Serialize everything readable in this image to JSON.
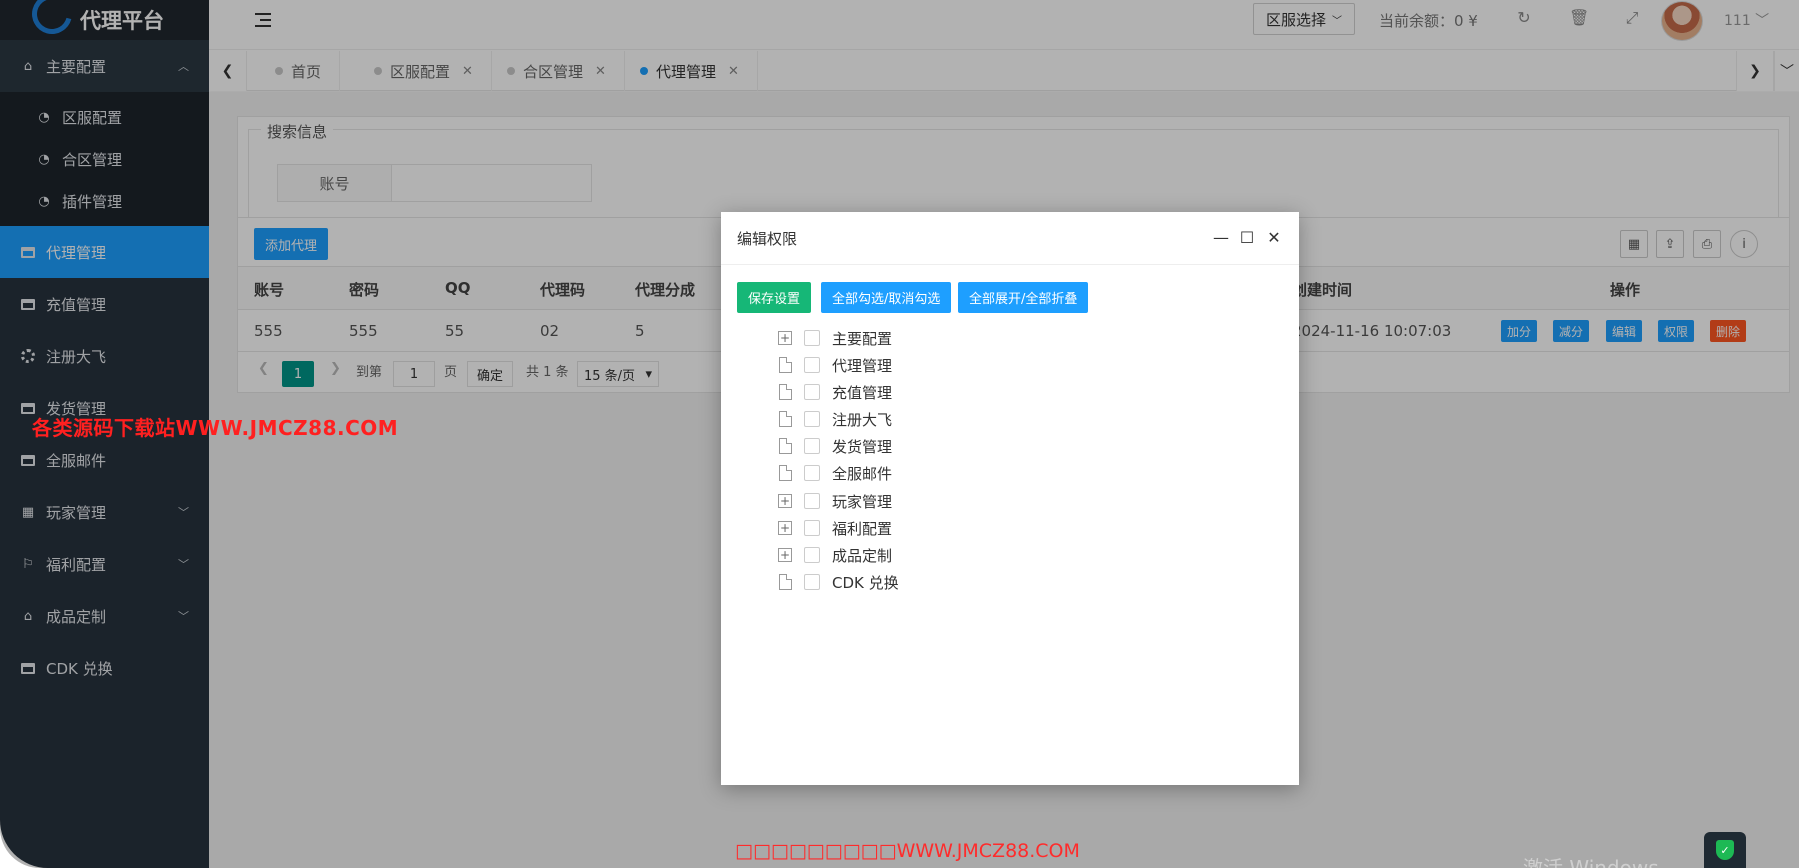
{
  "app": {
    "title": "代理平台"
  },
  "sidebar": {
    "groups": [
      {
        "label": "主要配置",
        "icon": "home-icon",
        "expanded": true,
        "children": [
          {
            "label": "区服配置",
            "icon": "dashboard-icon"
          },
          {
            "label": "合区管理",
            "icon": "dashboard-icon"
          },
          {
            "label": "插件管理",
            "icon": "dashboard-icon"
          }
        ]
      }
    ],
    "items": [
      {
        "label": "代理管理",
        "icon": "window-icon",
        "active": true
      },
      {
        "label": "充值管理",
        "icon": "window-icon"
      },
      {
        "label": "注册大飞",
        "icon": "gear-icon"
      },
      {
        "label": "发货管理",
        "icon": "window-icon"
      },
      {
        "label": "全服邮件",
        "icon": "window-icon"
      },
      {
        "label": "玩家管理",
        "icon": "calendar-icon",
        "has_children": true
      },
      {
        "label": "福利配置",
        "icon": "flag-icon",
        "has_children": true
      },
      {
        "label": "成品定制",
        "icon": "home-icon",
        "has_children": true
      },
      {
        "label": "CDK 兑换",
        "icon": "window-icon"
      }
    ]
  },
  "header": {
    "region_select": "区服选择",
    "balance": "当前余额：0 ¥",
    "user": "111",
    "icons": [
      "refresh-icon",
      "trash-icon",
      "fullscreen-icon"
    ]
  },
  "tabs": [
    {
      "label": "首页",
      "closable": false,
      "active": false
    },
    {
      "label": "区服配置",
      "closable": true,
      "active": false
    },
    {
      "label": "合区管理",
      "closable": true,
      "active": false
    },
    {
      "label": "代理管理",
      "closable": true,
      "active": true
    }
  ],
  "search": {
    "legend": "搜索信息",
    "account_label": "账号",
    "account_value": ""
  },
  "table": {
    "add_button": "添加代理",
    "columns": [
      "账号",
      "密码",
      "QQ",
      "代理码",
      "代理分成",
      "创建时间",
      "操作"
    ],
    "rows": [
      {
        "account": "555",
        "password": "555",
        "qq": "55",
        "code": "02",
        "share": "5",
        "created": "2024-11-16 10:07:03"
      }
    ],
    "row_actions": [
      "加分",
      "减分",
      "编辑",
      "权限",
      "删除"
    ],
    "pager": {
      "current_page": "1",
      "goto_prefix": "到第",
      "goto_value": "1",
      "goto_suffix": "页",
      "confirm": "确定",
      "total": "共 1 条",
      "page_size": "15 条/页"
    }
  },
  "modal": {
    "title": "编辑权限",
    "buttons": {
      "save": "保存设置",
      "toggle_check": "全部勾选/取消勾选",
      "toggle_expand": "全部展开/全部折叠"
    },
    "tree": [
      {
        "label": "主要配置",
        "expandable": true,
        "checked": false
      },
      {
        "label": "代理管理",
        "expandable": false,
        "checked": false
      },
      {
        "label": "充值管理",
        "expandable": false,
        "checked": false
      },
      {
        "label": "注册大飞",
        "expandable": false,
        "checked": false
      },
      {
        "label": "发货管理",
        "expandable": false,
        "checked": false
      },
      {
        "label": "全服邮件",
        "expandable": false,
        "checked": false
      },
      {
        "label": "玩家管理",
        "expandable": true,
        "checked": false
      },
      {
        "label": "福利配置",
        "expandable": true,
        "checked": false
      },
      {
        "label": "成品定制",
        "expandable": true,
        "checked": false
      },
      {
        "label": "CDK 兑换",
        "expandable": false,
        "checked": false
      }
    ]
  },
  "watermarks": {
    "left": "各类源码下载站WWW.JMCZ88.COM",
    "bottom_prefix": "□□□□□□□□□",
    "bottom_url": "WWW.JMCZ88.COM",
    "activate": "激活 Windows"
  },
  "colors": {
    "sidebar_bg": "#28333e",
    "accent": "#1e9fff",
    "teal": "#009688",
    "danger": "#ff5722",
    "watermark": "#ff2020"
  }
}
